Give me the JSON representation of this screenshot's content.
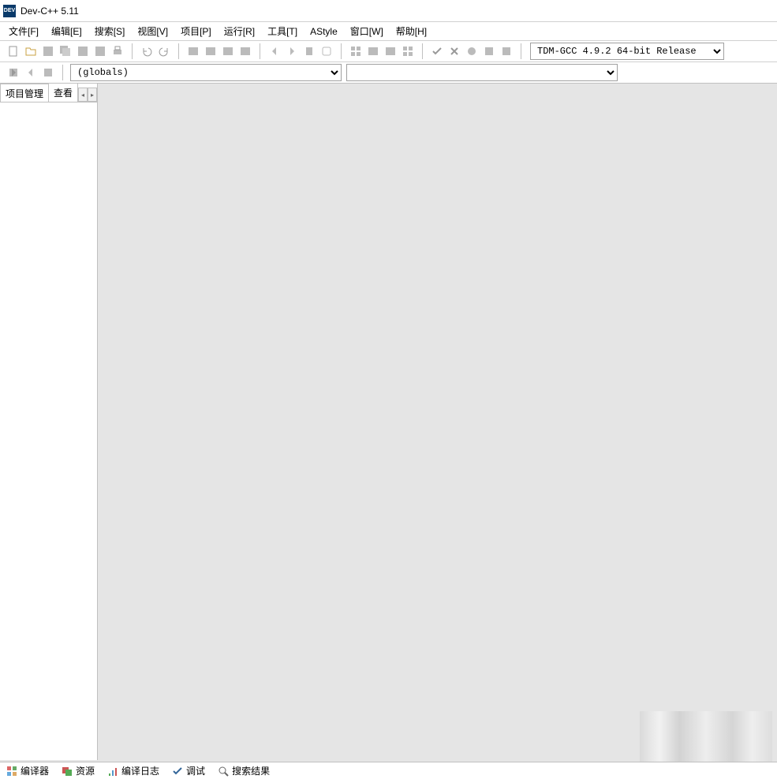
{
  "app": {
    "title": "Dev-C++ 5.11",
    "icon_label": "DEV"
  },
  "menu": {
    "file": "文件[F]",
    "edit": "编辑[E]",
    "search": "搜索[S]",
    "view": "视图[V]",
    "project": "项目[P]",
    "run": "运行[R]",
    "tools": "工具[T]",
    "astyle": "AStyle",
    "window": "窗口[W]",
    "help": "帮助[H]"
  },
  "toolbar": {
    "compiler_profile": "TDM-GCC 4.9.2 64-bit Release"
  },
  "toolbar2": {
    "globals_label": "(globals)",
    "members_label": ""
  },
  "sidepanel": {
    "tab_project": "项目管理",
    "tab_view": "查看"
  },
  "bottom": {
    "compiler": "编译器",
    "resources": "资源",
    "compile_log": "编译日志",
    "debug": "调试",
    "search_results": "搜索结果"
  }
}
